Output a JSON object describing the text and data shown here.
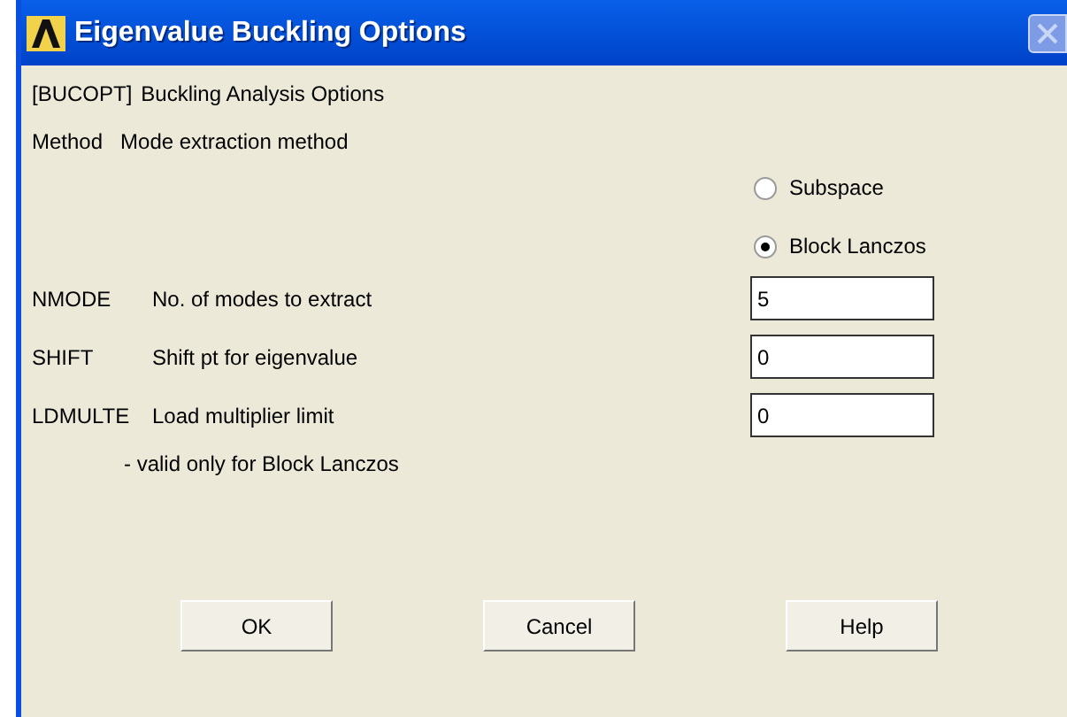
{
  "window": {
    "title": "Eigenvalue Buckling Options"
  },
  "header": {
    "command": "[BUCOPT]",
    "label": "Buckling Analysis Options"
  },
  "method": {
    "key": "Method",
    "label": "Mode extraction method",
    "options": [
      {
        "label": "Subspace",
        "selected": false
      },
      {
        "label": "Block Lanczos",
        "selected": true
      }
    ]
  },
  "fields": [
    {
      "key": "NMODE",
      "label": "No. of modes to extract",
      "value": "5"
    },
    {
      "key": "SHIFT",
      "label": "Shift pt for eigenvalue",
      "value": "0"
    },
    {
      "key": "LDMULTE",
      "label": "Load multiplier limit",
      "value": "0"
    }
  ],
  "note": "- valid only for Block Lanczos",
  "buttons": [
    "OK",
    "Cancel",
    "Help"
  ]
}
